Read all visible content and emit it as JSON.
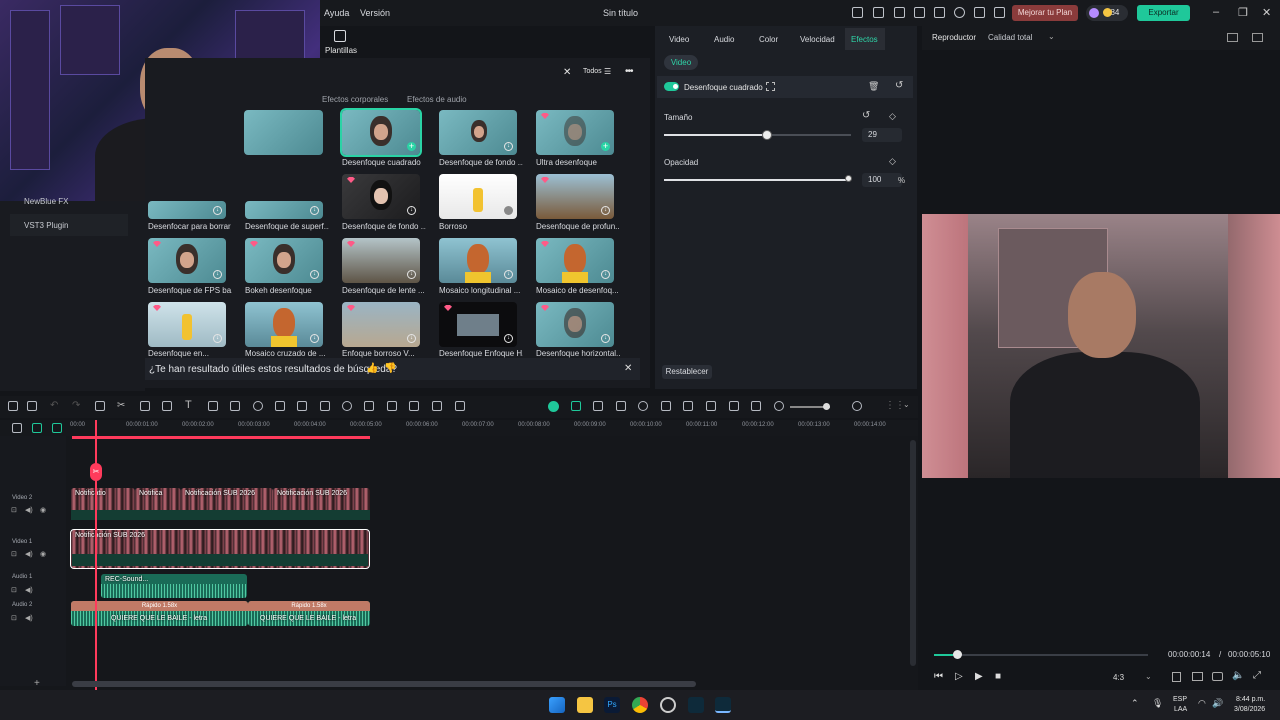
{
  "menu": {
    "help": "Ayuda",
    "version": "Versión",
    "title": "Sin título",
    "upgrade": "Mejorar tu Plan",
    "credits": "984",
    "export": "Exportar"
  },
  "left": {
    "newblue": "NewBlue FX",
    "vst3": "VST3 Plugin"
  },
  "effects_panel": {
    "templates": "Plantillas",
    "filter_all": "Todos",
    "categories": [
      "Efectos corporales",
      "Efectos de audio"
    ],
    "items": [
      {
        "label": "Desenfoque cuadrado"
      },
      {
        "label": "Desenfoque de fondo ..."
      },
      {
        "label": "Ultra desenfoque"
      },
      {
        "label": "Desenfocar para borrar"
      },
      {
        "label": "Desenfoque de superf..."
      },
      {
        "label": "Desenfoque de fondo ..."
      },
      {
        "label": "Borroso"
      },
      {
        "label": "Desenfoque de profun..."
      },
      {
        "label": "Desenfoque de FPS ba..."
      },
      {
        "label": "Bokeh desenfoque"
      },
      {
        "label": "Desenfoque de lente ..."
      },
      {
        "label": "Mosaico longitudinal ..."
      },
      {
        "label": "Mosaico de desenfoq..."
      },
      {
        "label": "Desenfoque en..."
      },
      {
        "label": "Mosaico cruzado de ..."
      },
      {
        "label": "Enfoque borroso V..."
      },
      {
        "label": "Desenfoque Enfoque H..."
      },
      {
        "label": "Desenfoque horizontal..."
      }
    ],
    "feedback": "¿Te han resultado útiles estos resultados de búsqueda?"
  },
  "props": {
    "tabs": [
      "Video",
      "Audio",
      "Color",
      "Velocidad",
      "Efectos"
    ],
    "chip": "Video",
    "effect_name": "Desenfoque cuadrado",
    "size_label": "Tamaño",
    "size_value": "29",
    "size_fraction": 0.29,
    "opacity_label": "Opacidad",
    "opacity_value": "100",
    "opacity_unit": "%",
    "opacity_fraction": 1.0,
    "reset": "Restablecer"
  },
  "player": {
    "label": "Reproductor",
    "quality": "Calidad total",
    "current": "00:00:00:14",
    "sep": "/",
    "total": "00:00:05:10",
    "ratio": "4:3",
    "progress_fraction": 0.09
  },
  "timeline": {
    "ticks": [
      "00:00",
      "00:00:01:00",
      "00:00:02:00",
      "00:00:03:00",
      "00:00:04:00",
      "00:00:05:00",
      "00:00:06:00",
      "00:00:07:00",
      "00:00:08:00",
      "00:00:09:00",
      "00:00:10:00",
      "00:00:11:00",
      "00:00:12:00",
      "00:00:13:00",
      "00:00:14:00"
    ],
    "tracks": [
      "Video 2",
      "Video 1",
      "Audio 1",
      "Audio 2"
    ],
    "v2_clips": [
      "Notificatio",
      "Notifica",
      "Notificación SUB 2026",
      "Notificación SUB 2026"
    ],
    "v1_clip": "Notificación SUB 2026",
    "a1_clip": "REC-Sound...",
    "speed": "Rápido 1.58x",
    "a2_clip": "QUIERE QUE LE BAILE - letra"
  },
  "taskbar": {
    "lang": "ESP",
    "lang2": "LAA",
    "time": "8:44 p.m.",
    "date": "3/08/2026"
  }
}
